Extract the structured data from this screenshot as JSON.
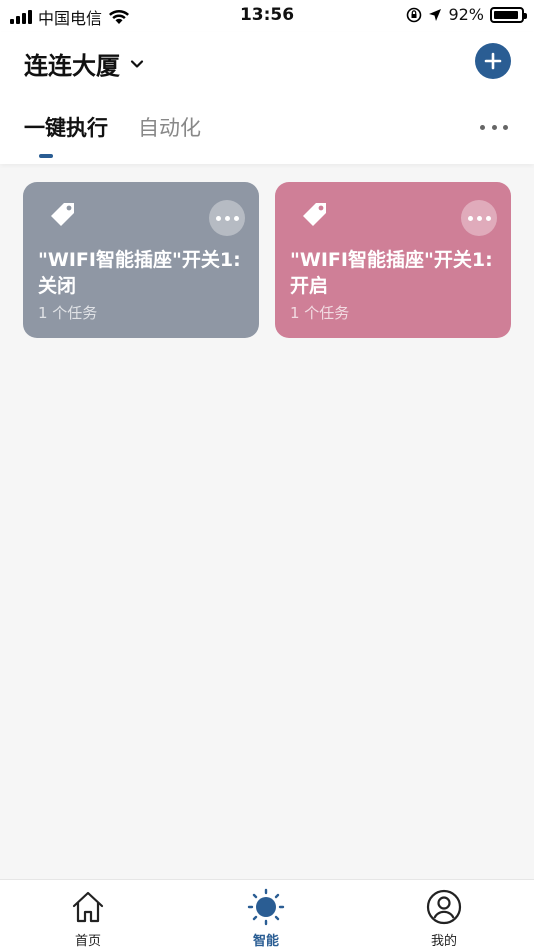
{
  "status_bar": {
    "carrier": "中国电信",
    "time": "13:56",
    "battery_text": "92%",
    "battery_level": 0.92,
    "icons": [
      "signal-icon",
      "wifi-icon",
      "orientation-lock-icon",
      "location-icon",
      "battery-icon"
    ]
  },
  "header": {
    "home_name": "连连大厦",
    "home_dropdown_icon": "chevron-down-icon",
    "add_icon": "plus-icon",
    "more_icon": "more-horizontal-icon"
  },
  "tabs": [
    {
      "label": "一键执行",
      "active": true
    },
    {
      "label": "自动化",
      "active": false
    }
  ],
  "scenes": [
    {
      "name": "\"WIFI智能插座\"开关1:关闭",
      "task_count": "1 个任务",
      "color": "#8f97a4",
      "icon": "tag-icon"
    },
    {
      "name": "\"WIFI智能插座\"开关1:开启",
      "task_count": "1 个任务",
      "color": "#cf7f97",
      "icon": "tag-icon"
    }
  ],
  "bottom_nav": [
    {
      "label": "首页",
      "icon": "home-icon",
      "active": false
    },
    {
      "label": "智能",
      "icon": "sun-icon",
      "active": true
    },
    {
      "label": "我的",
      "icon": "profile-icon",
      "active": false
    }
  ],
  "colors": {
    "accent": "#2a5d93",
    "background": "#f6f6f6"
  }
}
